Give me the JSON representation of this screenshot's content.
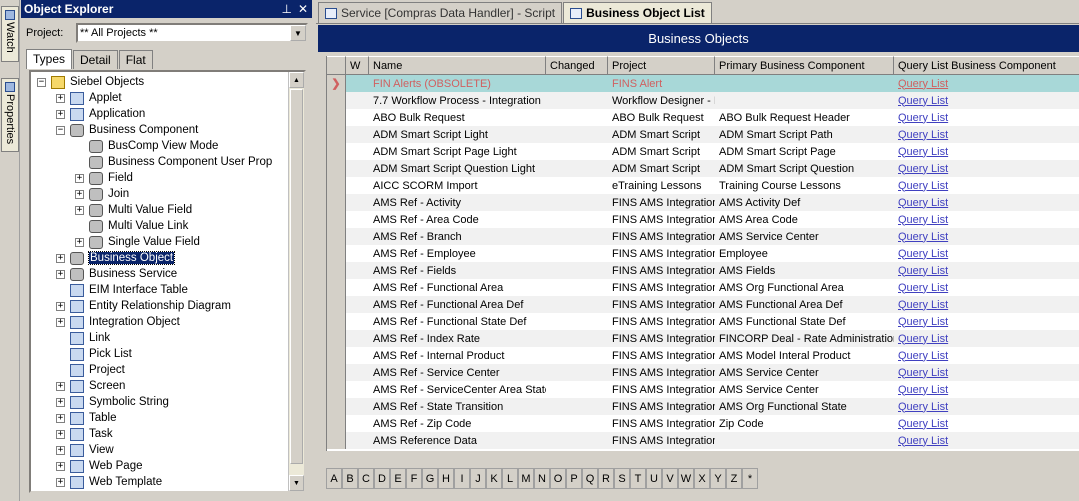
{
  "side_tabs": {
    "watch": "Watch",
    "properties": "Properties"
  },
  "explorer": {
    "title": "Object Explorer",
    "pin": "⊥",
    "close": "✕",
    "project_label": "Project:",
    "project_value": "** All Projects **",
    "tabs": [
      "Types",
      "Detail",
      "Flat"
    ],
    "tree": [
      {
        "label": "Siebel Objects",
        "level": 0,
        "exp": "−",
        "icon": "folder"
      },
      {
        "label": "Applet",
        "level": 1,
        "exp": "+",
        "icon": "obj"
      },
      {
        "label": "Application",
        "level": 1,
        "exp": "+",
        "icon": "obj"
      },
      {
        "label": "Business Component",
        "level": 1,
        "exp": "−",
        "icon": "gear"
      },
      {
        "label": "BusComp View Mode",
        "level": 2,
        "exp": "",
        "icon": "gear"
      },
      {
        "label": "Business Component User Prop",
        "level": 2,
        "exp": "",
        "icon": "gear"
      },
      {
        "label": "Field",
        "level": 2,
        "exp": "+",
        "icon": "gear"
      },
      {
        "label": "Join",
        "level": 2,
        "exp": "+",
        "icon": "gear"
      },
      {
        "label": "Multi Value Field",
        "level": 2,
        "exp": "+",
        "icon": "gear"
      },
      {
        "label": "Multi Value Link",
        "level": 2,
        "exp": "",
        "icon": "gear"
      },
      {
        "label": "Single Value Field",
        "level": 2,
        "exp": "+",
        "icon": "gear"
      },
      {
        "label": "Business Object",
        "level": 1,
        "exp": "+",
        "icon": "gear",
        "selected": true
      },
      {
        "label": "Business Service",
        "level": 1,
        "exp": "+",
        "icon": "gear"
      },
      {
        "label": "EIM Interface Table",
        "level": 1,
        "exp": "",
        "icon": "obj"
      },
      {
        "label": "Entity Relationship Diagram",
        "level": 1,
        "exp": "+",
        "icon": "obj"
      },
      {
        "label": "Integration Object",
        "level": 1,
        "exp": "+",
        "icon": "obj"
      },
      {
        "label": "Link",
        "level": 1,
        "exp": "",
        "icon": "obj"
      },
      {
        "label": "Pick List",
        "level": 1,
        "exp": "",
        "icon": "obj"
      },
      {
        "label": "Project",
        "level": 1,
        "exp": "",
        "icon": "obj"
      },
      {
        "label": "Screen",
        "level": 1,
        "exp": "+",
        "icon": "obj"
      },
      {
        "label": "Symbolic String",
        "level": 1,
        "exp": "+",
        "icon": "obj"
      },
      {
        "label": "Table",
        "level": 1,
        "exp": "+",
        "icon": "obj"
      },
      {
        "label": "Task",
        "level": 1,
        "exp": "+",
        "icon": "obj"
      },
      {
        "label": "View",
        "level": 1,
        "exp": "+",
        "icon": "obj"
      },
      {
        "label": "Web Page",
        "level": 1,
        "exp": "+",
        "icon": "obj"
      },
      {
        "label": "Web Template",
        "level": 1,
        "exp": "+",
        "icon": "obj"
      }
    ]
  },
  "doc_tabs": [
    "Service [Compras Data Handler] - Script",
    "Business Object List"
  ],
  "list": {
    "title": "Business Objects",
    "columns": [
      "",
      "W",
      "Name",
      "Changed",
      "Project",
      "Primary Business Component",
      "Query List Business Component"
    ],
    "rows": [
      {
        "sel": "❯",
        "name": "FIN Alerts (OBSOLETE)",
        "project": "FINS Alert",
        "pbc": "",
        "q": "Query List",
        "cur": true
      },
      {
        "sel": "",
        "name": "7.7 Workflow Process - Integration",
        "project": "Workflow Designer - I",
        "pbc": "",
        "q": "Query List"
      },
      {
        "sel": "",
        "name": "ABO Bulk Request",
        "project": "ABO Bulk Request",
        "pbc": "ABO Bulk Request Header",
        "q": "Query List"
      },
      {
        "sel": "",
        "name": "ADM Smart Script Light",
        "project": "ADM Smart Script",
        "pbc": "ADM Smart Script Path",
        "q": "Query List"
      },
      {
        "sel": "",
        "name": "ADM Smart Script Page Light",
        "project": "ADM Smart Script",
        "pbc": "ADM Smart Script Page",
        "q": "Query List"
      },
      {
        "sel": "",
        "name": "ADM Smart Script Question Light",
        "project": "ADM Smart Script",
        "pbc": "ADM Smart Script Question",
        "q": "Query List"
      },
      {
        "sel": "",
        "name": "AICC SCORM Import",
        "project": "eTraining Lessons",
        "pbc": "Training Course Lessons",
        "q": "Query List"
      },
      {
        "sel": "",
        "name": "AMS Ref - Activity",
        "project": "FINS AMS Integration",
        "pbc": "AMS Activity Def",
        "q": "Query List"
      },
      {
        "sel": "",
        "name": "AMS Ref - Area Code",
        "project": "FINS AMS Integration",
        "pbc": "AMS Area Code",
        "q": "Query List"
      },
      {
        "sel": "",
        "name": "AMS Ref - Branch",
        "project": "FINS AMS Integration",
        "pbc": "AMS Service Center",
        "q": "Query List"
      },
      {
        "sel": "",
        "name": "AMS Ref - Employee",
        "project": "FINS AMS Integration",
        "pbc": "Employee",
        "q": "Query List"
      },
      {
        "sel": "",
        "name": "AMS Ref - Fields",
        "project": "FINS AMS Integration",
        "pbc": "AMS Fields",
        "q": "Query List"
      },
      {
        "sel": "",
        "name": "AMS Ref - Functional Area",
        "project": "FINS AMS Integration",
        "pbc": "AMS Org Functional Area",
        "q": "Query List"
      },
      {
        "sel": "",
        "name": "AMS Ref - Functional Area Def",
        "project": "FINS AMS Integration",
        "pbc": "AMS Functional Area Def",
        "q": "Query List"
      },
      {
        "sel": "",
        "name": "AMS Ref - Functional State Def",
        "project": "FINS AMS Integration",
        "pbc": "AMS Functional State Def",
        "q": "Query List"
      },
      {
        "sel": "",
        "name": "AMS Ref - Index Rate",
        "project": "FINS AMS Integration",
        "pbc": "FINCORP Deal - Rate Administration",
        "q": "Query List"
      },
      {
        "sel": "",
        "name": "AMS Ref - Internal Product",
        "project": "FINS AMS Integration",
        "pbc": "AMS Model Interal Product",
        "q": "Query List"
      },
      {
        "sel": "",
        "name": "AMS Ref - Service Center",
        "project": "FINS AMS Integration",
        "pbc": "AMS Service Center",
        "q": "Query List"
      },
      {
        "sel": "",
        "name": "AMS Ref - ServiceCenter Area State",
        "project": "FINS AMS Integration",
        "pbc": "AMS Service Center",
        "q": "Query List"
      },
      {
        "sel": "",
        "name": "AMS Ref - State Transition",
        "project": "FINS AMS Integration",
        "pbc": "AMS Org Functional State",
        "q": "Query List"
      },
      {
        "sel": "",
        "name": "AMS Ref - Zip Code",
        "project": "FINS AMS Integration",
        "pbc": "Zip Code",
        "q": "Query List"
      },
      {
        "sel": "",
        "name": "AMS Reference Data",
        "project": "FINS AMS Integration",
        "pbc": "",
        "q": "Query List"
      }
    ]
  },
  "alphabet": [
    "A",
    "B",
    "C",
    "D",
    "E",
    "F",
    "G",
    "H",
    "I",
    "J",
    "K",
    "L",
    "M",
    "N",
    "O",
    "P",
    "Q",
    "R",
    "S",
    "T",
    "U",
    "V",
    "W",
    "X",
    "Y",
    "Z",
    "*"
  ]
}
